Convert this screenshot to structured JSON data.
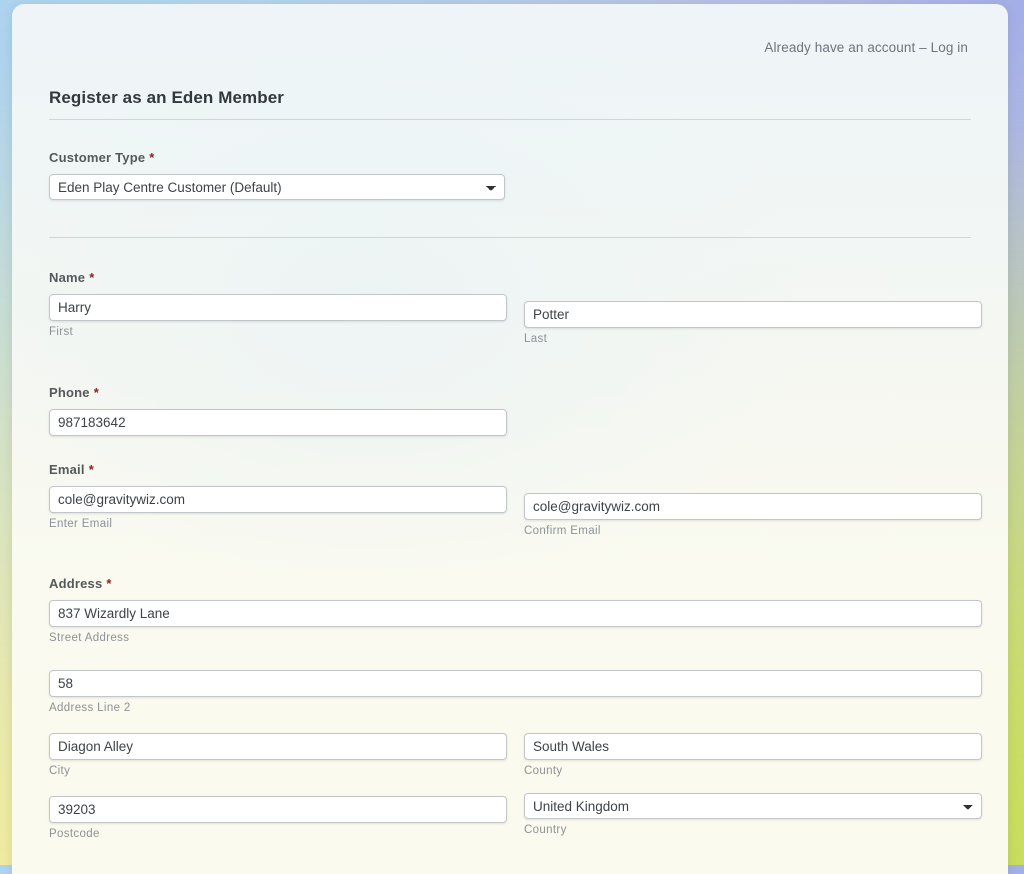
{
  "header": {
    "login_text": "Already have an account – Log in",
    "title": "Register as an Eden Member"
  },
  "form": {
    "required_marker": "*",
    "customer_type": {
      "label": "Customer Type",
      "value": "Eden Play Centre Customer (Default)",
      "options": [
        "Eden Play Centre Customer (Default)"
      ],
      "icon": "chevron-down-icon"
    },
    "name": {
      "label": "Name",
      "first": {
        "value": "Harry",
        "sublabel": "First"
      },
      "last": {
        "value": "Potter",
        "sublabel": "Last"
      }
    },
    "phone": {
      "label": "Phone",
      "value": "987183642"
    },
    "email": {
      "label": "Email",
      "enter": {
        "value": "cole@gravitywiz.com",
        "sublabel": "Enter Email"
      },
      "confirm": {
        "value": "cole@gravitywiz.com",
        "sublabel": "Confirm Email"
      }
    },
    "address": {
      "label": "Address",
      "street": {
        "value": "837 Wizardly Lane",
        "sublabel": "Street Address"
      },
      "line2": {
        "value": "58",
        "sublabel": "Address Line 2"
      },
      "city": {
        "value": "Diagon Alley",
        "sublabel": "City"
      },
      "county": {
        "value": "South Wales",
        "sublabel": "County"
      },
      "postcode": {
        "value": "39203",
        "sublabel": "Postcode"
      },
      "country": {
        "value": "United Kingdom",
        "sublabel": "Country",
        "options": [
          "United Kingdom"
        ],
        "icon": "chevron-down-icon"
      }
    }
  },
  "colors": {
    "required": "#8b1f1f",
    "label": "#55595c",
    "sublabel": "#8d9296",
    "title": "#33383d",
    "link": "#6d757d",
    "input_border": "#c2c6c9"
  }
}
